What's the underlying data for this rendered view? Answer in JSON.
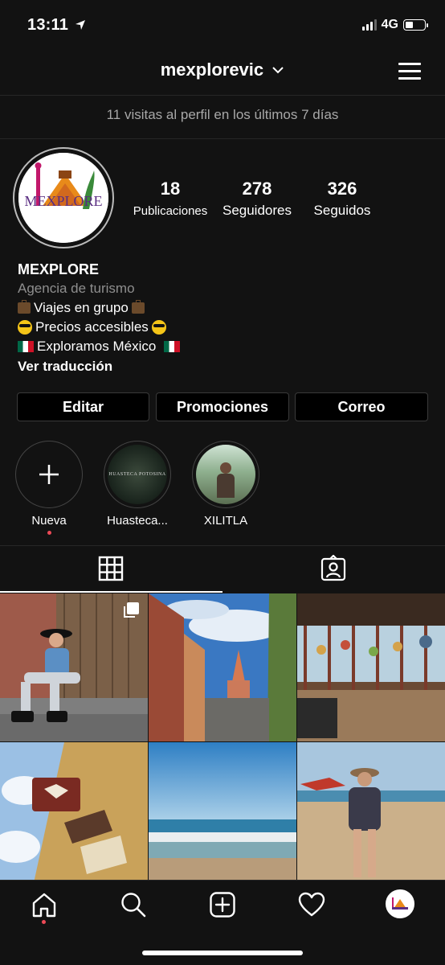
{
  "status": {
    "time": "13:11",
    "network": "4G",
    "battery_level": 0.45
  },
  "header": {
    "username": "mexplorevic",
    "visits": "11 visitas al perfil en los últimos 7 días"
  },
  "profile": {
    "avatar_text": "MEXPLORE",
    "stats": [
      {
        "value": "18",
        "label": "Publicaciones"
      },
      {
        "value": "278",
        "label": "Seguidores"
      },
      {
        "value": "326",
        "label": "Seguidos"
      }
    ],
    "name": "MEXPLORE",
    "category": "Agencia de turismo",
    "bio": [
      "Viajes en grupo",
      "Precios accesibles",
      "Exploramos México"
    ],
    "translate_link": "Ver traducción"
  },
  "actions": [
    "Editar",
    "Promociones",
    "Correo"
  ],
  "highlights": [
    {
      "label": "Nueva",
      "cover_text": ""
    },
    {
      "label": "Huasteca...",
      "cover_text": "HUASTECA POTOSINA"
    },
    {
      "label": "XILITLA",
      "cover_text": ""
    }
  ],
  "tabs": [
    "grid-icon",
    "tagged-icon"
  ],
  "nav": [
    "home-icon",
    "search-icon",
    "new-post-icon",
    "heart-icon",
    "profile-avatar"
  ],
  "colors": {
    "background": "#121212",
    "muted": "#a8a8a8",
    "notification": "#ed4956"
  }
}
